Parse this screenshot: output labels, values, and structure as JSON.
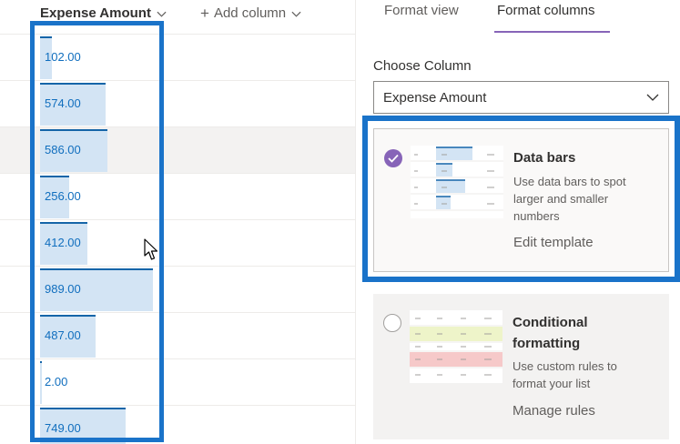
{
  "list": {
    "amount_header": "Expense Amount",
    "add_column_label": "Add column",
    "rows": [
      {
        "value": "102.00",
        "fraction": 0.103
      },
      {
        "value": "574.00",
        "fraction": 0.58
      },
      {
        "value": "586.00",
        "fraction": 0.593
      },
      {
        "value": "256.00",
        "fraction": 0.259
      },
      {
        "value": "412.00",
        "fraction": 0.417
      },
      {
        "value": "989.00",
        "fraction": 1.0
      },
      {
        "value": "487.00",
        "fraction": 0.492
      },
      {
        "value": "2.00",
        "fraction": 0.002
      },
      {
        "value": "749.00",
        "fraction": 0.757
      }
    ],
    "selected_row_index": 2
  },
  "panel": {
    "tabs": [
      {
        "label": "Format view",
        "active": false
      },
      {
        "label": "Format columns",
        "active": true
      }
    ],
    "choose_column_label": "Choose Column",
    "choose_column_value": "Expense Amount",
    "data_bars": {
      "title": "Data bars",
      "desc_line1": "Use data bars to spot",
      "desc_line2": "larger and smaller",
      "desc_line3": "numbers",
      "link": "Edit template",
      "selected": true
    },
    "conditional": {
      "title_line1": "Conditional",
      "title_line2": "formatting",
      "desc_line1": "Use custom rules to",
      "desc_line2": "format your list",
      "link": "Manage rules",
      "selected": false
    }
  },
  "colors": {
    "bar_fill": "#d3e4f4",
    "bar_edge": "#1565a8",
    "value_text": "#106ebe",
    "accent_purple": "#8764b8",
    "highlight": "#1a73c9"
  }
}
